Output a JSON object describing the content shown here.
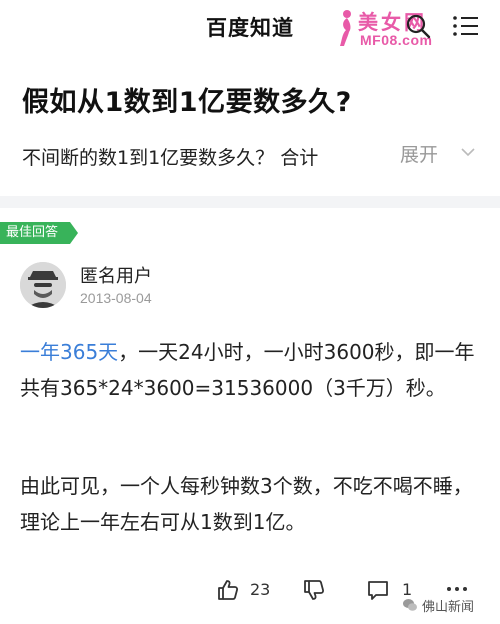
{
  "header": {
    "title": "百度知道",
    "watermark_cn": "美女网",
    "watermark_en": "MF08.com",
    "icons": [
      "search-icon",
      "menu-icon"
    ]
  },
  "question": {
    "title": "假如从1数到1亿要数多久?",
    "description": "不间断的数1到1亿要数多久？ 合计",
    "expand_label": "展开"
  },
  "answer": {
    "badge": "最佳回答",
    "user_name": "匿名用户",
    "date": "2013-08-04",
    "p1_link": "一年365天",
    "p1_rest": "，一天24小时，一小时3600秒，即一年共有365*24*3600=31536000（3千万）秒。",
    "p2": "由此可见，一个人每秒钟数3个数，不吃不喝不睡，理论上一年左右可从1数到1亿。"
  },
  "actions": {
    "like_count": "23",
    "comment_count": "1"
  },
  "footer_watermark": {
    "text": "佛山新闻"
  },
  "colors": {
    "accent_green": "#38b35a",
    "link_blue": "#3a7ed8",
    "watermark_pink": "#e85aa8"
  }
}
